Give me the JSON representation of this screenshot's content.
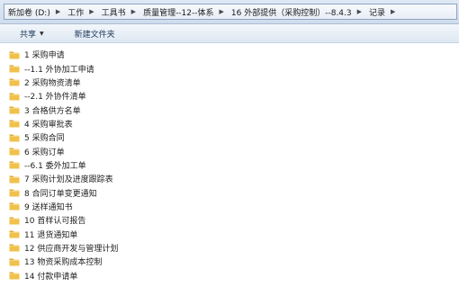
{
  "address": {
    "crumbs": [
      "新加卷 (D:)",
      "工作",
      "工具书",
      "质量管理--12--体系",
      "16 外部提供（采购控制）--8.4.3",
      "记录"
    ],
    "separator_icon": "chevron-right-icon"
  },
  "toolbar": {
    "share_label": "共享",
    "new_folder_label": "新建文件夹"
  },
  "files": [
    "1 采购申请",
    "--1.1 外协加工申请",
    "2 采购物资清单",
    "--2.1 外协件清单",
    "3 合格供方名单",
    "4 采购审批表",
    "5 采购合同",
    "6 采购订单",
    "--6.1 委外加工单",
    "7 采购计划及进度跟踪表",
    "8 合同订单变更通知",
    "9 送样通知书",
    "10 首样认可报告",
    "11 退货通知单",
    "12 供应商开发与管理计划",
    "13 物资采购成本控制",
    "14 付款申请单"
  ],
  "colors": {
    "folder_fill": "#f0c14b",
    "folder_dark": "#d9a22c",
    "toolbar_text": "#1e395b"
  }
}
